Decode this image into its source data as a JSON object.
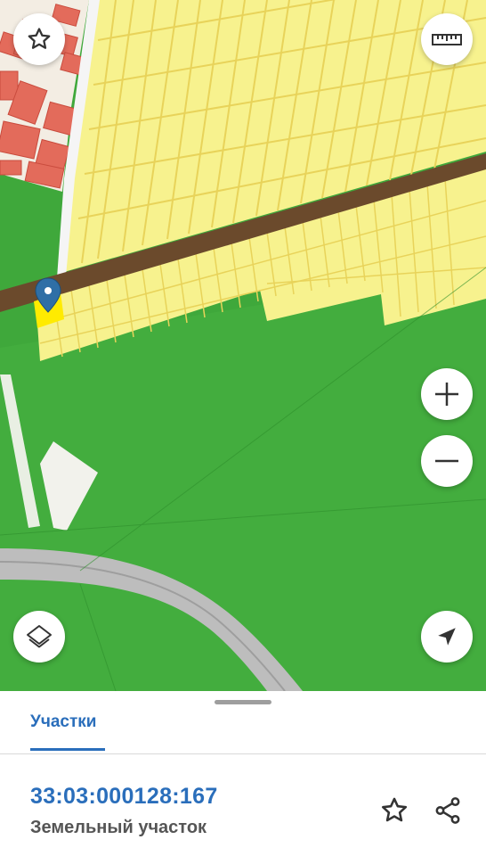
{
  "map": {
    "colors": {
      "forest": "#3fa83b",
      "forest_light": "#52bd4a",
      "residential": "#f7f28e",
      "parcel_lines": "#e8d35a",
      "road": "#6b4a2c",
      "built_up": "#e36b5b",
      "highway": "#bdbdbd",
      "marker": "#2f6fa6"
    },
    "controls": {
      "favorite": "star-icon",
      "ruler": "ruler-icon",
      "zoom_in": "plus-icon",
      "zoom_out": "minus-icon",
      "layers": "layers-icon",
      "locate": "location-arrow-icon"
    }
  },
  "sheet": {
    "tab_label": "Участки",
    "parcel": {
      "cadastral_number": "33:03:000128:167",
      "type": "Земельный участок"
    },
    "actions": {
      "favorite": "star-outline-icon",
      "share": "share-icon"
    },
    "accent_color": "#2a6ebb"
  }
}
